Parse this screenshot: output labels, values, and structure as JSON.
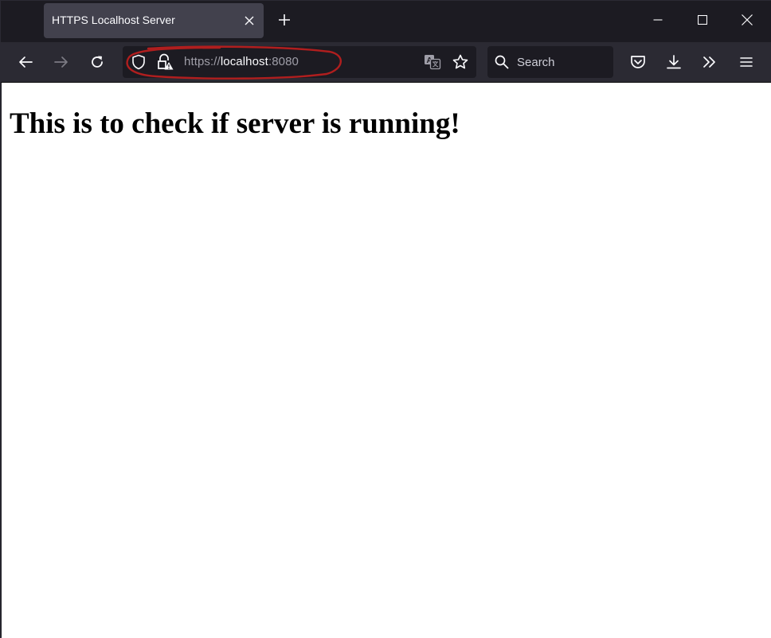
{
  "tab": {
    "title": "HTTPS Localhost Server"
  },
  "urlbar": {
    "scheme": "https://",
    "host": "localhost",
    "port": ":8080"
  },
  "search": {
    "label": "Search"
  },
  "page": {
    "heading": "This is to check if server is running!"
  },
  "icons": {
    "tab_close": "close-icon",
    "new_tab": "plus-icon",
    "back": "arrow-left-icon",
    "forward": "arrow-right-icon",
    "reload": "reload-icon",
    "tracking_protection": "shield-icon",
    "connection": "lock-warning-icon",
    "translate": "translate-icon",
    "bookmark": "star-icon",
    "search": "search-icon",
    "pocket": "pocket-icon",
    "downloads": "download-icon",
    "overflow": "chevrons-right-icon",
    "menu": "hamburger-icon"
  },
  "colors": {
    "chrome_dark": "#1c1b22",
    "toolbar": "#2b2a33",
    "tab_selected": "#42414d",
    "icon": "#fbfbfe",
    "annotation": "#b01e1e"
  }
}
